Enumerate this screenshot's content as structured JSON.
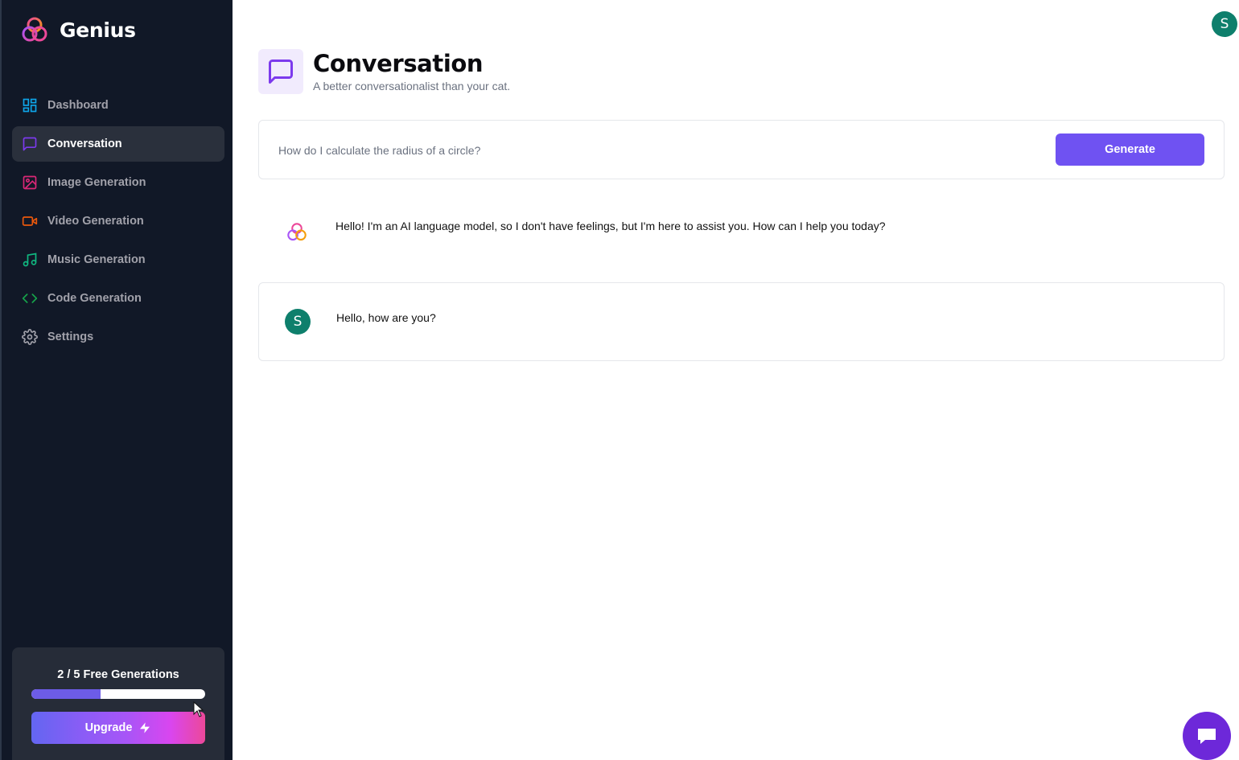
{
  "brand": {
    "name": "Genius"
  },
  "sidebar": {
    "items": [
      {
        "label": "Dashboard",
        "icon": "dashboard-icon",
        "color": "#0ea5e9",
        "active": false
      },
      {
        "label": "Conversation",
        "icon": "message-square-icon",
        "color": "#7c3aed",
        "active": true
      },
      {
        "label": "Image Generation",
        "icon": "image-icon",
        "color": "#db2777",
        "active": false
      },
      {
        "label": "Video Generation",
        "icon": "video-icon",
        "color": "#ea580c",
        "active": false
      },
      {
        "label": "Music Generation",
        "icon": "music-icon",
        "color": "#10b981",
        "active": false
      },
      {
        "label": "Code Generation",
        "icon": "code-icon",
        "color": "#16a34a",
        "active": false
      },
      {
        "label": "Settings",
        "icon": "gear-icon",
        "color": "#a1a1aa",
        "active": false
      }
    ],
    "free_generations": {
      "text": "2 / 5 Free Generations",
      "used": 2,
      "limit": 5,
      "progress_fraction": 0.4
    },
    "upgrade_label": "Upgrade"
  },
  "header": {
    "title": "Conversation",
    "subtitle": "A better conversationalist than your cat.",
    "icon": "message-square-icon",
    "icon_color": "#7c3aed",
    "icon_bg": "#f1ebfd"
  },
  "prompt": {
    "value": "",
    "placeholder": "How do I calculate the radius of a circle?",
    "button_label": "Generate",
    "button_color": "#6f52f2"
  },
  "messages": [
    {
      "role": "bot",
      "text": "Hello! I'm an AI language model, so I don't have feelings, but I'm here to assist you. How can I help you today?"
    },
    {
      "role": "user",
      "avatar_initial": "S",
      "text": "Hello, how are you?"
    }
  ],
  "user": {
    "avatar_initial": "S",
    "avatar_color": "#0e7f6c"
  },
  "chat_launcher": {
    "icon": "chat-bubble-icon",
    "color": "#6d28d9"
  }
}
